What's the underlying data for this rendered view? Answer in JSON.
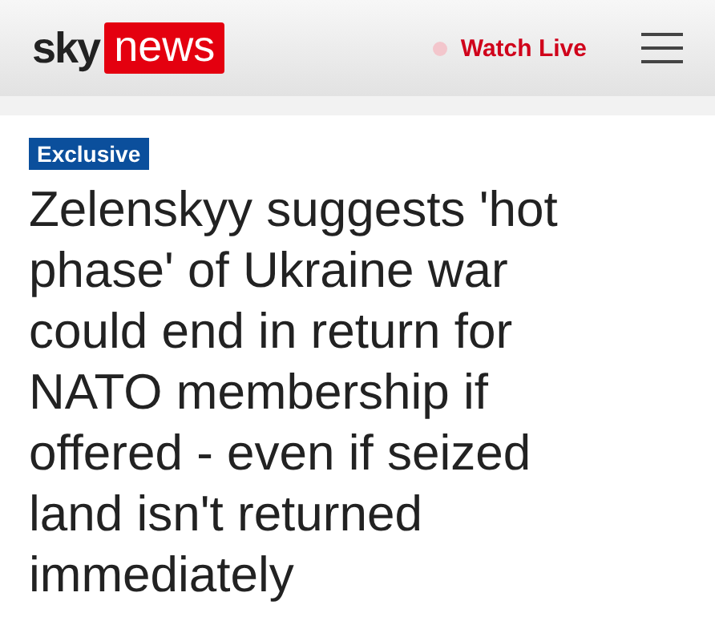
{
  "header": {
    "logo": {
      "sky": "sky",
      "news": "news"
    },
    "watch_live": "Watch Live"
  },
  "article": {
    "badge": "Exclusive",
    "headline": "Zelenskyy suggests 'hot phase' of Ukraine war could end in return for NATO membership if offered - even if seized land isn't returned immediately"
  }
}
